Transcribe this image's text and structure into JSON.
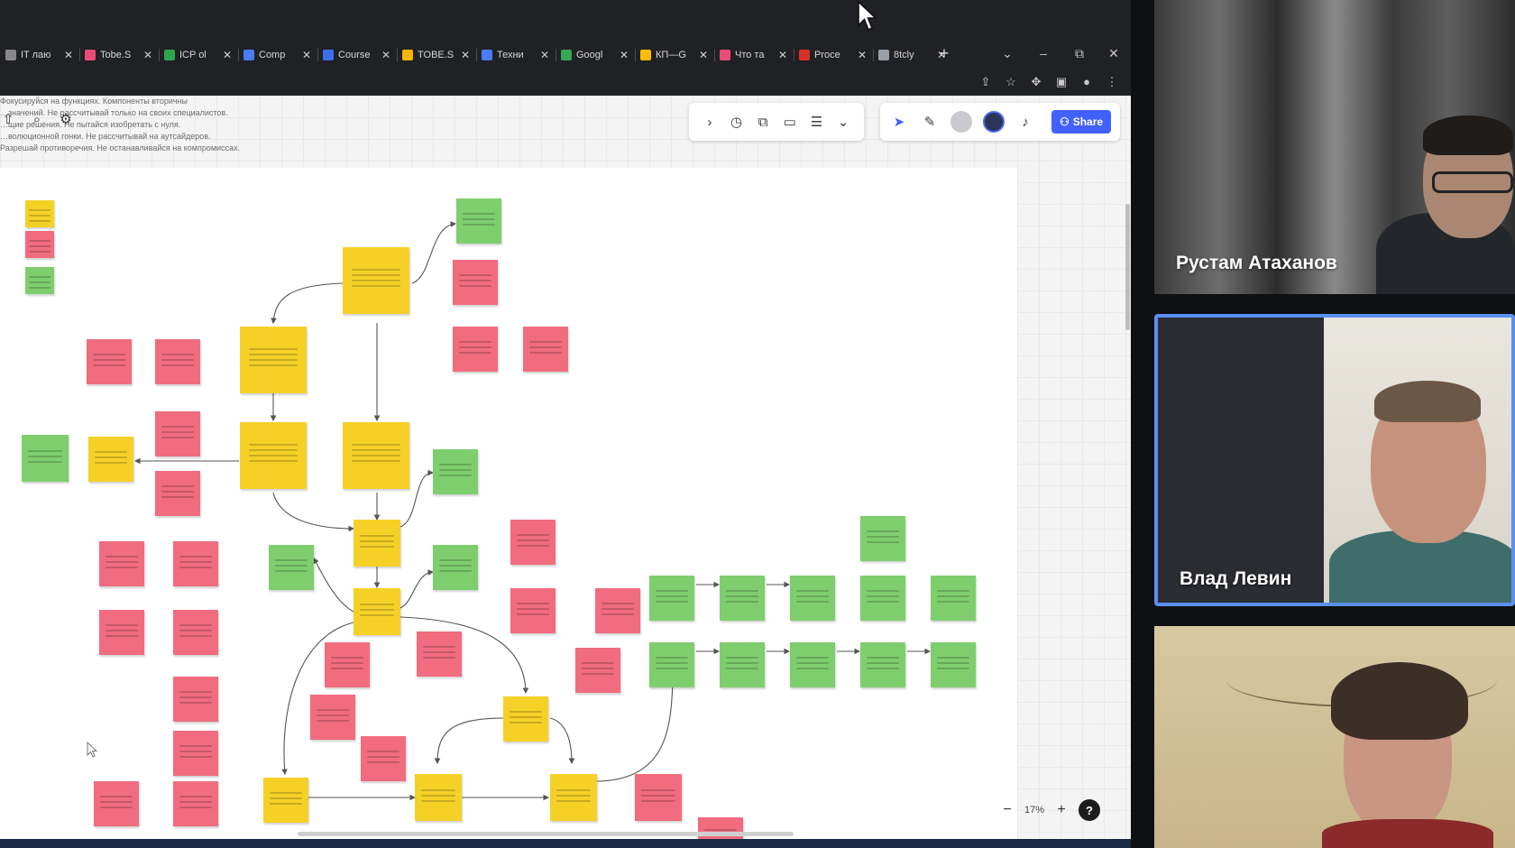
{
  "browser": {
    "tabs": [
      {
        "label": "IT лаю",
        "color": "#888888"
      },
      {
        "label": "Tobe.S",
        "color": "#e94c7a"
      },
      {
        "label": "ICP ol",
        "color": "#2ea44f"
      },
      {
        "label": "Comp",
        "color": "#4a7cf7"
      },
      {
        "label": "Course",
        "color": "#3b6ff0"
      },
      {
        "label": "TOBE.S",
        "color": "#f4b400"
      },
      {
        "label": "Техни",
        "color": "#4a7cf7"
      },
      {
        "label": "Googl",
        "color": "#34a853"
      },
      {
        "label": "КП—G",
        "color": "#fbbc04"
      },
      {
        "label": "Что та",
        "color": "#e94c7a"
      },
      {
        "label": "Proce",
        "color": "#d93025"
      },
      {
        "label": "8tcly",
        "color": "#9aa0a6"
      }
    ],
    "new_tab": "+",
    "window_controls": [
      "⌄",
      "–",
      "⧉",
      "✕"
    ],
    "address_icons": [
      "share-icon",
      "star-icon",
      "extensions-icon",
      "sidebar-icon",
      "profile-icon",
      "menu-icon"
    ]
  },
  "board": {
    "notes_text": [
      "Фокусируйся на функциях. Компоненты вторичны",
      "…значений. Не рассчитывай только на своих специалистов.",
      "…щие решения. Не пытайся изобретать с нуля.",
      "…волюционной гонки. Не рассчитывай на аутсайдеров.",
      "Разрешай противоречия. Не останавливайся на компромиссах."
    ],
    "toolbar1_icons": [
      "chevron-right-icon",
      "timer-icon",
      "frame-icon",
      "presentation-icon",
      "notes-icon",
      "more-icon"
    ],
    "toolbar2_icons": [
      "cursor-mode-icon",
      "reactions-icon"
    ],
    "share_label": "Share",
    "zoom": "17%",
    "zoom_minus": "−",
    "zoom_plus": "+",
    "help": "?"
  },
  "participants": [
    {
      "name": "Рустам Атаханов",
      "active": false
    },
    {
      "name": "Влад Левин",
      "active": true
    },
    {
      "name": "",
      "active": false
    }
  ],
  "colors": {
    "accent": "#4262ff",
    "sticky_yellow": "#f5d128",
    "sticky_red": "#f16c7f",
    "sticky_green": "#7fce6e",
    "speaker_border": "#5b8ff1"
  }
}
